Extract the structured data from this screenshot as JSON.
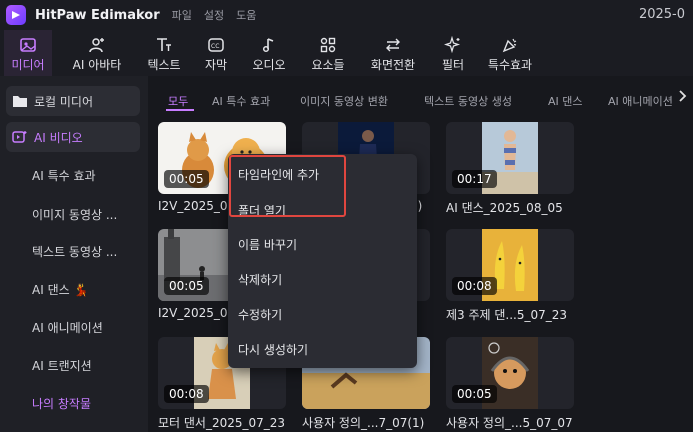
{
  "app": {
    "title": "HitPaw Edimakor",
    "menus": [
      "파일",
      "설정",
      "도움"
    ],
    "clock": "2025-0",
    "accent": "#c77dff"
  },
  "toolbar": [
    {
      "label": "미디어",
      "icon": "media-icon",
      "active": true
    },
    {
      "label": "AI 아바타",
      "icon": "avatar-add-icon",
      "active": false
    },
    {
      "label": "텍스트",
      "icon": "text-icon",
      "active": false
    },
    {
      "label": "자막",
      "icon": "caption-icon",
      "active": false
    },
    {
      "label": "오디오",
      "icon": "music-note-icon",
      "active": false
    },
    {
      "label": "요소들",
      "icon": "elements-icon",
      "active": false
    },
    {
      "label": "화면전환",
      "icon": "transition-icon",
      "active": false
    },
    {
      "label": "필터",
      "icon": "sparkle-icon",
      "active": false
    },
    {
      "label": "특수효과",
      "icon": "effects-icon",
      "active": false
    }
  ],
  "sidebar": {
    "local_media": "로컬 미디어",
    "ai_video": "AI 비디오",
    "items": [
      "AI 특수 효과",
      "이미지 동영상 ...",
      "텍스트 동영상 ...",
      "AI 댄스",
      "AI 애니메이션",
      "AI 트랜지션",
      "나의 창작물"
    ]
  },
  "tabs": [
    "모두",
    "AI 특수 효과",
    "이미지 동영상 변환",
    "텍스트 동영상 생성",
    "AI 댄스",
    "AI 애니메이션"
  ],
  "cards": [
    {
      "duration": "00:05",
      "caption": "I2V_2025_08"
    },
    {
      "duration": "",
      "caption": "1)"
    },
    {
      "duration": "00:17",
      "caption": "AI 댄스_2025_08_05"
    },
    {
      "duration": "00:05",
      "caption": "I2V_2025_08"
    },
    {
      "duration": "",
      "caption": ""
    },
    {
      "duration": "00:08",
      "caption": "제3 주제 댄...5_07_23"
    },
    {
      "duration": "00:08",
      "caption": "모터 댄서_2025_07_23"
    },
    {
      "duration": "",
      "caption": "사용자 정의_...7_07(1)"
    },
    {
      "duration": "00:05",
      "caption": "사용자 정의_...5_07_07"
    }
  ],
  "context_menu": [
    "타임라인에 추가",
    "폴더 열기",
    "이름 바꾸기",
    "삭제하기",
    "수정하기",
    "다시 생성하기"
  ]
}
